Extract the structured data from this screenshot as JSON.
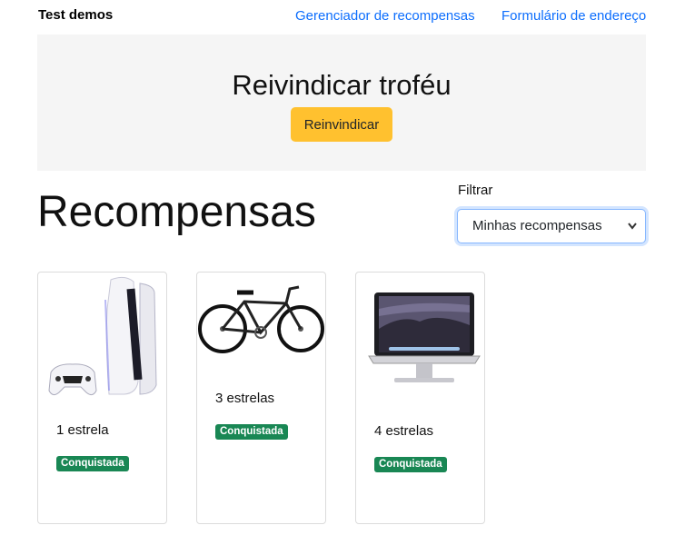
{
  "nav": {
    "brand": "Test demos",
    "links": [
      "Gerenciador de recompensas",
      "Formulário de endereço"
    ]
  },
  "hero": {
    "title": "Reivindicar troféu",
    "button": "Reinvindicar"
  },
  "main": {
    "title": "Recompensas",
    "filter_label": "Filtrar",
    "filter_value": "Minhas recompensas"
  },
  "rewards": [
    {
      "image": "game-console-icon",
      "stars": "1 estrela",
      "status": "Conquistada"
    },
    {
      "image": "bicycle-icon",
      "stars": "3 estrelas",
      "status": "Conquistada"
    },
    {
      "image": "laptop-icon",
      "stars": "4 estrelas",
      "status": "Conquistada"
    }
  ],
  "colors": {
    "link": "#0d6efd",
    "hero_bg": "#f5f5f5",
    "button": "#ffc12f",
    "badge": "#198754"
  }
}
